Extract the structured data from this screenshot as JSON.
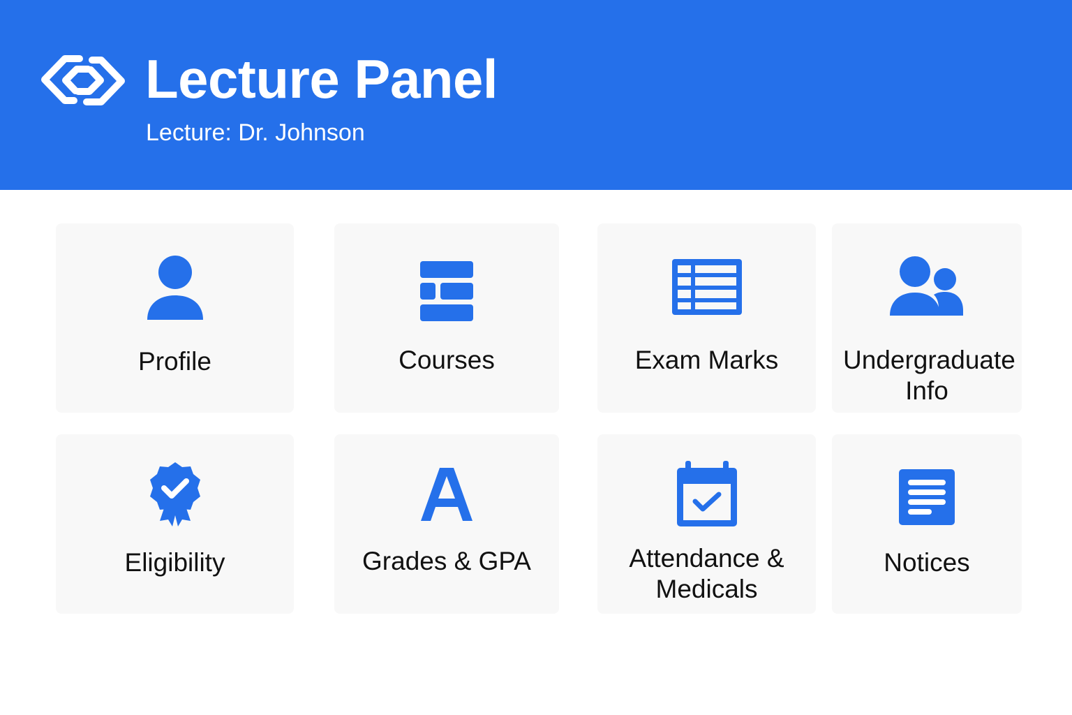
{
  "header": {
    "title": "Lecture Panel",
    "subtitle": "Lecture: Dr. Johnson",
    "logo_icon": "chain-link-icon",
    "background_color": "#2570EA"
  },
  "accent_color": "#2570EA",
  "tiles": [
    {
      "label": "Profile",
      "icon": "user-icon"
    },
    {
      "label": "Courses",
      "icon": "list-icon"
    },
    {
      "label": "Exam Marks",
      "icon": "table-icon"
    },
    {
      "label": "Undergraduate Info",
      "icon": "users-icon"
    },
    {
      "label": "Eligibility",
      "icon": "badge-check-icon"
    },
    {
      "label": "Grades & GPA",
      "icon": "letter-a-icon"
    },
    {
      "label": "Attendance & Medicals",
      "icon": "calendar-check-icon"
    },
    {
      "label": "Notices",
      "icon": "notice-icon"
    }
  ]
}
